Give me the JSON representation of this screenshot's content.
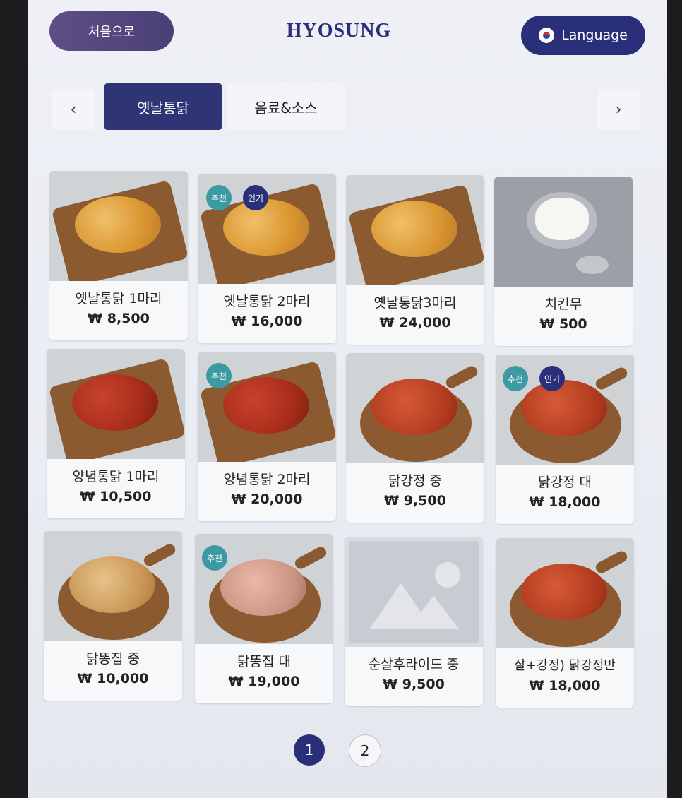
{
  "header": {
    "home_label": "처음으로",
    "logo": "HYOSUNG",
    "language_label": "Language"
  },
  "tabs": [
    {
      "label": "옛날통닭",
      "active": true
    },
    {
      "label": "음료&소스",
      "active": false
    }
  ],
  "nav": {
    "prev": "‹",
    "next": "›"
  },
  "items": [
    {
      "name": "옛날통닭 1마리",
      "price": "₩ 8,500",
      "badges": []
    },
    {
      "name": "옛날통닭 2마리",
      "price": "₩ 16,000",
      "badges": [
        "추천",
        "인기"
      ]
    },
    {
      "name": "옛날통닭3마리",
      "price": "₩ 24,000",
      "badges": []
    },
    {
      "name": "치킨무",
      "price": "₩ 500",
      "badges": []
    },
    {
      "name": "양념통닭 1마리",
      "price": "₩ 10,500",
      "badges": []
    },
    {
      "name": "양념통닭 2마리",
      "price": "₩ 20,000",
      "badges": [
        "추천"
      ]
    },
    {
      "name": "닭강정 중",
      "price": "₩ 9,500",
      "badges": []
    },
    {
      "name": "닭강정 대",
      "price": "₩ 18,000",
      "badges": [
        "추천",
        "인기"
      ]
    },
    {
      "name": "닭똥집 중",
      "price": "₩ 10,000",
      "badges": []
    },
    {
      "name": "닭똥집 대",
      "price": "₩ 19,000",
      "badges": [
        "추천"
      ]
    },
    {
      "name": "순살후라이드 중",
      "price": "₩ 9,500",
      "badges": []
    },
    {
      "name": "살+강정)      닭강정반",
      "price": "₩ 18,000",
      "badges": []
    }
  ],
  "pagination": {
    "pages": [
      "1",
      "2"
    ],
    "current": "1"
  },
  "colors": {
    "primary": "#2a2f7a",
    "home_button": "#5e4f86",
    "recommend_badge": "#3c9aa3"
  }
}
